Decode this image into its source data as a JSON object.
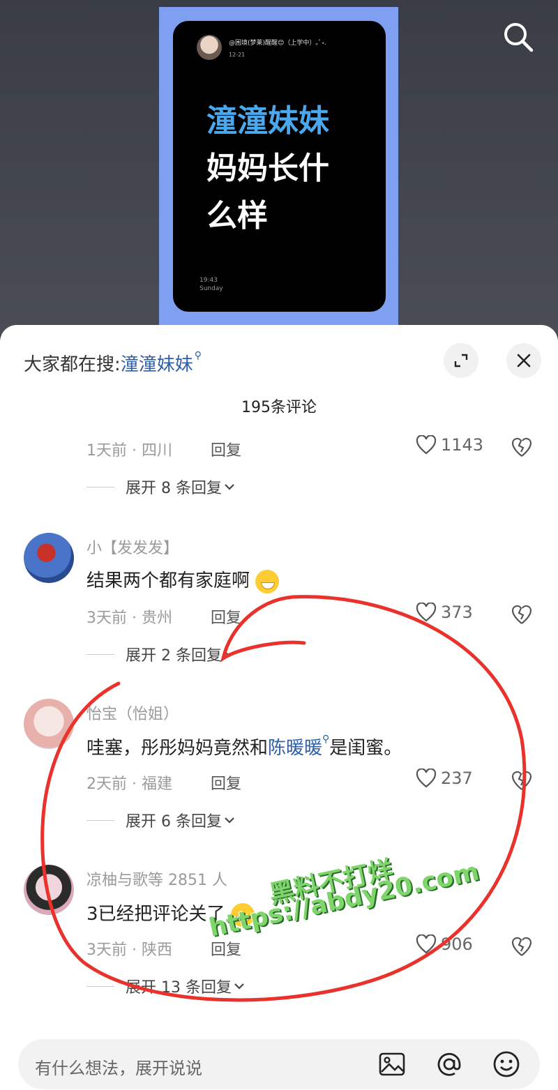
{
  "video_card": {
    "username": "@困境(梦莱)醒醒😊（上学中）｡ﾟ˖.",
    "date": "12-21",
    "title_highlight": "潼潼妹妹",
    "title_line2": "妈妈长什",
    "title_line3": "么样",
    "time": "19:43",
    "day": "Sunday"
  },
  "sheet": {
    "trending_prefix": "大家都在搜:",
    "trending_keyword": "潼潼妹妹",
    "comment_count": "195条评论"
  },
  "comments": [
    {
      "username": "",
      "text": "",
      "meta": "1天前 · 四川",
      "reply": "回复",
      "likes": "1143",
      "expand": "展开 8 条回复"
    },
    {
      "username": "小【发发发】",
      "text": "结果两个都有家庭啊",
      "meta": "3天前 · 贵州",
      "reply": "回复",
      "likes": "373",
      "expand": "展开 2 条回复"
    },
    {
      "username": "怡宝（怡姐）",
      "text_before": "哇塞，彤彤妈妈竟然和",
      "text_keyword": "陈暖暖",
      "text_after": "是闺蜜。",
      "meta": "2天前 · 福建",
      "reply": "回复",
      "likes": "237",
      "expand": "展开 6 条回复"
    },
    {
      "username": "凉柚与歌等 2851 人",
      "text": "3已经把评论关了",
      "meta": "3天前 · 陕西",
      "reply": "回复",
      "likes": "906",
      "expand": "展开 13 条回复"
    }
  ],
  "input": {
    "placeholder": "有什么想法，展开说说"
  },
  "watermark": {
    "line1": "黑料不打烊",
    "line2": "https://abdy20.com"
  },
  "colors": {
    "keyword_blue": "#2f5fa8",
    "annotation_red": "#e8322b",
    "watermark_green": "#7ed66b"
  },
  "icons": [
    "search-icon",
    "expand-icon",
    "close-icon",
    "heart-icon",
    "broken-heart-icon",
    "chevron-down-icon",
    "image-icon",
    "at-icon",
    "emoji-icon"
  ]
}
